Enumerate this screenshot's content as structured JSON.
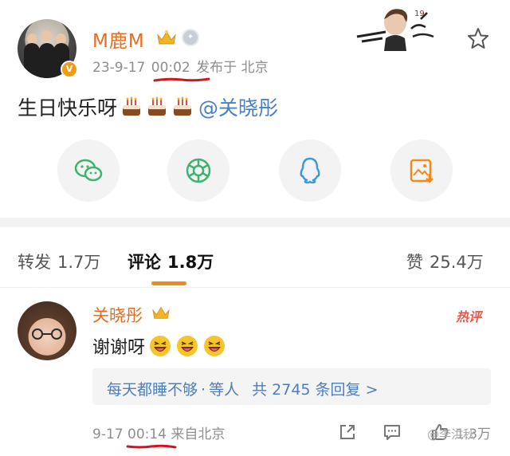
{
  "post": {
    "author": "M鹿M",
    "date": "23-9-17",
    "time": "00:02",
    "source": "发布于 北京",
    "text": "生日快乐呀",
    "mention": "@关晓彤"
  },
  "share_buttons": [
    {
      "icon": "wechat-icon"
    },
    {
      "icon": "moments-icon"
    },
    {
      "icon": "qq-icon"
    },
    {
      "icon": "save-image-icon"
    }
  ],
  "tabs": {
    "repost_label": "转发",
    "repost_count": "1.7万",
    "comment_label": "评论",
    "comment_count": "1.8万",
    "like_label": "赞",
    "like_count": "25.4万"
  },
  "comment": {
    "author": "关晓彤",
    "hot_badge": "热评",
    "text": "谢谢呀",
    "reply_summary": "每天都睡不够",
    "reply_sep": "·",
    "reply_others": "等人",
    "reply_total": "共 2745 条回复 >",
    "date": "9-17",
    "time": "00:14",
    "source": "来自北京",
    "like_count": "1.3万"
  },
  "watermark": "@李洪秋",
  "colors": {
    "accent": "#f28a1a",
    "name": "#e76c1b",
    "link": "#4a7fc1",
    "annotation": "#d4141b"
  }
}
